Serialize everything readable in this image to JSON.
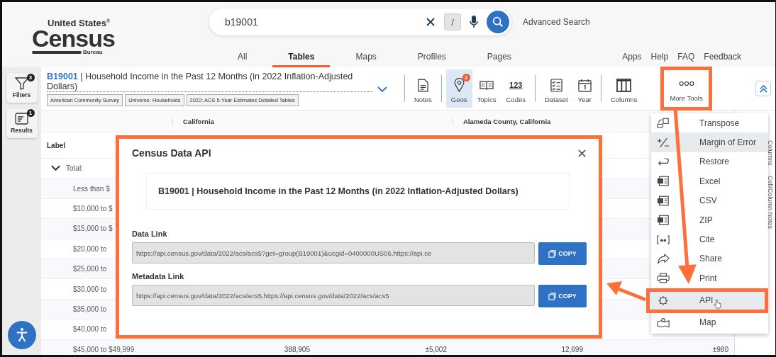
{
  "logo": {
    "line_1": "United States",
    "mark": "®",
    "line_2": "Census",
    "line_3": "Bureau"
  },
  "search": {
    "value": "b19001",
    "shortcut": "/",
    "advanced_link": "Advanced Search"
  },
  "nav_tabs": [
    {
      "label": "All",
      "selected": false
    },
    {
      "label": "Tables",
      "selected": true
    },
    {
      "label": "Maps",
      "selected": false
    },
    {
      "label": "Profiles",
      "selected": false
    },
    {
      "label": "Pages",
      "selected": false
    }
  ],
  "utility_links": [
    "Apps",
    "Help",
    "FAQ",
    "Feedback"
  ],
  "sidebar": [
    {
      "label": "Filters",
      "badge": "3",
      "kind": "filter"
    },
    {
      "label": "Results",
      "badge": "1",
      "kind": "results"
    }
  ],
  "table_title": {
    "code": "B19001",
    "separator": "|",
    "title": "Household Income in the Past 12 Months (in 2022 Inflation-Adjusted Dollars)",
    "tags": [
      "American Community Survey",
      "Universe: Households",
      "2022: ACS 5-Year Estimates Detailed Tables"
    ]
  },
  "toolbar": [
    {
      "label": "Notes",
      "kind": "notes",
      "selected": false
    },
    {
      "label": "Geos",
      "kind": "geos",
      "selected": true,
      "badge": "2"
    },
    {
      "label": "Topics",
      "kind": "topics",
      "selected": false
    },
    {
      "label": "Codes",
      "kind": "codes",
      "selected": false,
      "icon_text": "123"
    },
    {
      "label": "Dataset",
      "kind": "dataset",
      "selected": false
    },
    {
      "label": "Year",
      "kind": "year",
      "selected": false
    },
    {
      "label": "Columns",
      "kind": "columns",
      "selected": false
    },
    {
      "label": "More Tools",
      "kind": "more",
      "selected": false
    }
  ],
  "table": {
    "geographies": [
      "California",
      "Alameda County, California"
    ],
    "label_header": "Label",
    "rows": [
      {
        "label": "Total:",
        "kind": "group",
        "expanded": true
      },
      {
        "label": "Less than $",
        "kind": "item"
      },
      {
        "label": "$10,000 to $",
        "kind": "item"
      },
      {
        "label": "$15,000 to $",
        "kind": "item"
      },
      {
        "label": "$20,000 to",
        "kind": "item"
      },
      {
        "label": "$25,000 to",
        "kind": "item"
      },
      {
        "label": "$30,000 to",
        "kind": "item"
      },
      {
        "label": "$35,000 to",
        "kind": "item"
      },
      {
        "label": "$40,000 to",
        "kind": "item"
      },
      {
        "label": "$45,000 to $49,999",
        "kind": "item",
        "values": [
          "388,905",
          "±5,002",
          "12,699",
          "±980"
        ]
      }
    ]
  },
  "side_tabs": [
    "Columns",
    "Cell/Column Notes"
  ],
  "menu": [
    {
      "label": "Transpose",
      "kind": "transpose",
      "selected": false
    },
    {
      "label": "Margin of Error",
      "kind": "moe",
      "selected": true
    },
    {
      "label": "Restore",
      "kind": "restore",
      "selected": false
    },
    {
      "label": "Excel",
      "kind": "file",
      "selected": false
    },
    {
      "label": "CSV",
      "kind": "file",
      "selected": false
    },
    {
      "label": "ZIP",
      "kind": "file",
      "selected": false
    },
    {
      "label": "Cite",
      "kind": "cite",
      "selected": false
    },
    {
      "label": "Share",
      "kind": "share",
      "selected": false
    },
    {
      "label": "Print",
      "kind": "print",
      "selected": false
    },
    {
      "label": "API",
      "kind": "api",
      "selected": true
    },
    {
      "label": "Map",
      "kind": "map",
      "selected": false
    }
  ],
  "modal": {
    "title": "Census Data API",
    "table_code": "B19001",
    "separator": "|",
    "table_title": "Household Income in the Past 12 Months (in 2022 Inflation-Adjusted Dollars)",
    "links": [
      {
        "label": "Data Link",
        "value": "https://api.census.gov/data/2022/acs/acs5?get=group(B19001)&ucgid=0400000US06,https://api.ce",
        "button": "COPY"
      },
      {
        "label": "Metadata Link",
        "value": "https://api.census.gov/data/2022/acs/acs5,https://api.census.gov/data/2022/acs/acs5",
        "button": "COPY"
      }
    ]
  }
}
